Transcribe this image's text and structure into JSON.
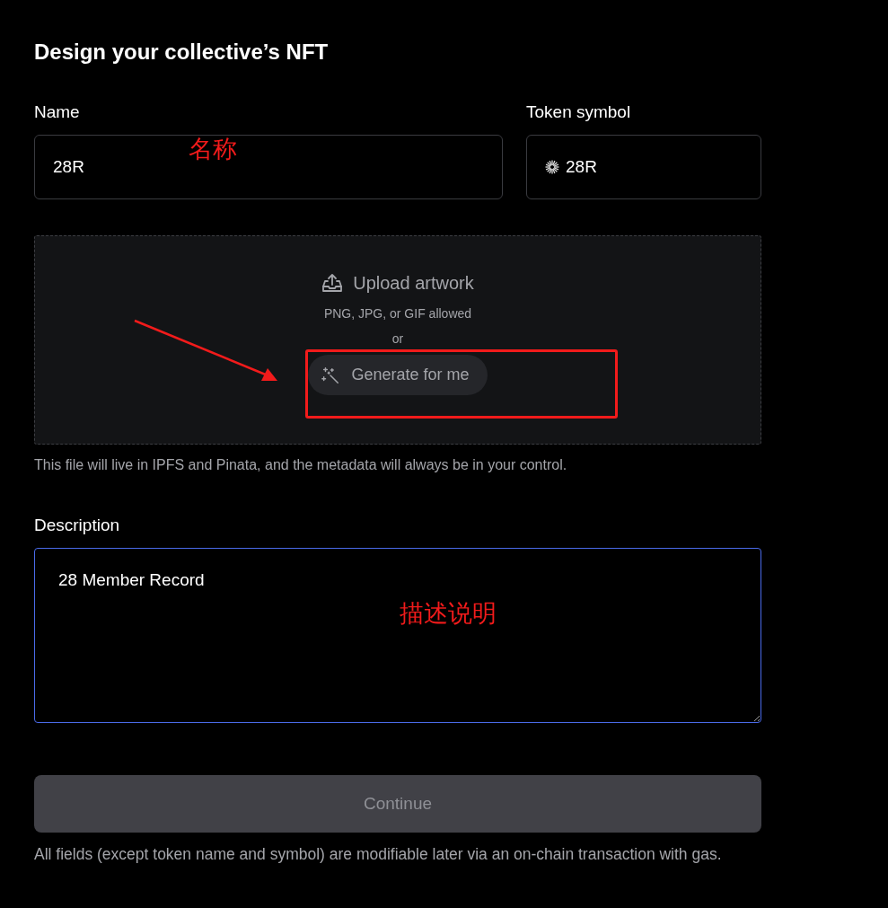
{
  "title": "Design your collective’s NFT",
  "name_field": {
    "label": "Name",
    "value": "28R"
  },
  "token_field": {
    "label": "Token symbol",
    "value": "28R"
  },
  "upload": {
    "title": "Upload artwork",
    "formats": "PNG, JPG, or GIF allowed",
    "separator": "or",
    "generate_button": "Generate for me",
    "note": "This file will live in IPFS and Pinata, and the metadata will always be in your control."
  },
  "description_field": {
    "label": "Description",
    "value": "28 Member Record",
    "focused": true
  },
  "continue_button": {
    "label": "Continue",
    "disabled": true
  },
  "footnote": "All fields (except token name and symbol) are modifiable later via an on-chain transaction with gas.",
  "annotations": [
    {
      "kind": "text",
      "text": "名称"
    },
    {
      "kind": "arrow"
    },
    {
      "kind": "frame"
    },
    {
      "kind": "text",
      "text": "描述说明"
    }
  ]
}
